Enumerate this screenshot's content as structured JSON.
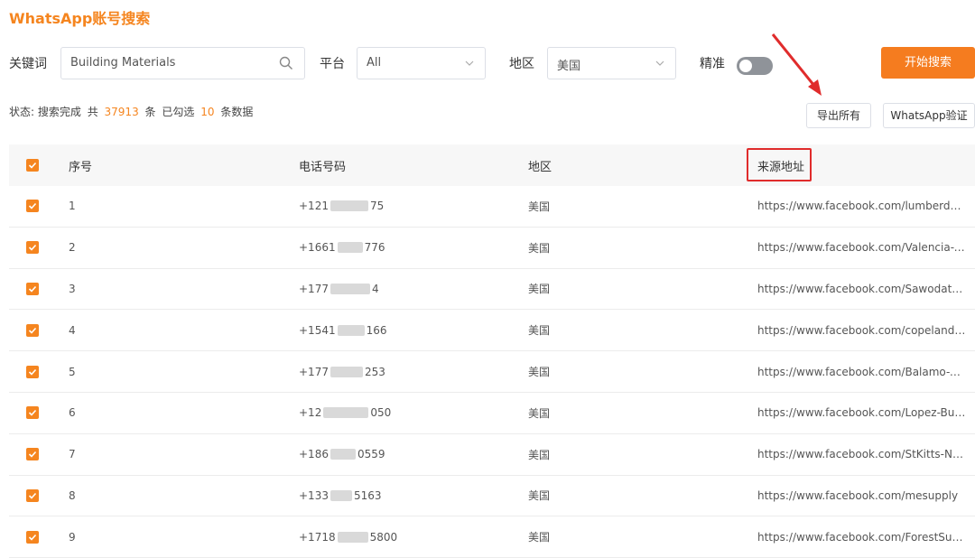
{
  "app": {
    "title": "WhatsApp账号搜索"
  },
  "search": {
    "keyword_label": "关键词",
    "keyword_value": "Building Materials",
    "platform_label": "平台",
    "platform_value": "All",
    "region_label": "地区",
    "region_value": "美国",
    "precise_label": "精准",
    "start_button": "开始搜索"
  },
  "status": {
    "prefix": "状态: 搜索完成",
    "total_prefix": "共",
    "total": "37913",
    "total_suffix": "条",
    "selected_prefix": "已勾选",
    "selected": "10",
    "selected_suffix": "条数据"
  },
  "actions": {
    "export_all": "导出所有",
    "whatsapp_verify": "WhatsApp验证"
  },
  "table": {
    "headers": {
      "index": "序号",
      "phone": "电话号码",
      "region": "地区",
      "source": "来源地址"
    },
    "rows": [
      {
        "index": "1",
        "phone_a": "+121",
        "phone_b": "75",
        "region": "美国",
        "source": "https://www.facebook.com/lumberdepot"
      },
      {
        "index": "2",
        "phone_a": "+1661",
        "phone_b": "776",
        "region": "美国",
        "source": "https://www.facebook.com/Valencia-Building-Supply"
      },
      {
        "index": "3",
        "phone_a": "+177",
        "phone_b": "4",
        "region": "美国",
        "source": "https://www.facebook.com/Sawodatrading"
      },
      {
        "index": "4",
        "phone_a": "+1541",
        "phone_b": "166",
        "region": "美国",
        "source": "https://www.facebook.com/copelandlumber"
      },
      {
        "index": "5",
        "phone_a": "+177",
        "phone_b": "253",
        "region": "美国",
        "source": "https://www.facebook.com/Balamo-Building"
      },
      {
        "index": "6",
        "phone_a": "+12",
        "phone_b": "050",
        "region": "美国",
        "source": "https://www.facebook.com/Lopez-Building-Materials"
      },
      {
        "index": "7",
        "phone_a": "+186",
        "phone_b": "0559",
        "region": "美国",
        "source": "https://www.facebook.com/StKitts-Nevis"
      },
      {
        "index": "8",
        "phone_a": "+133",
        "phone_b": "5163",
        "region": "美国",
        "source": "https://www.facebook.com/mesupply"
      },
      {
        "index": "9",
        "phone_a": "+1718",
        "phone_b": "5800",
        "region": "美国",
        "source": "https://www.facebook.com/ForestSupply"
      }
    ]
  },
  "colors": {
    "accent": "#f5851f",
    "button": "#f57c1f",
    "highlight": "#e02c2c"
  },
  "icons": {
    "search": "search-icon",
    "dropdown": "chevron-down-icon",
    "check": "check-icon",
    "arrow": "arrow-annotation"
  }
}
